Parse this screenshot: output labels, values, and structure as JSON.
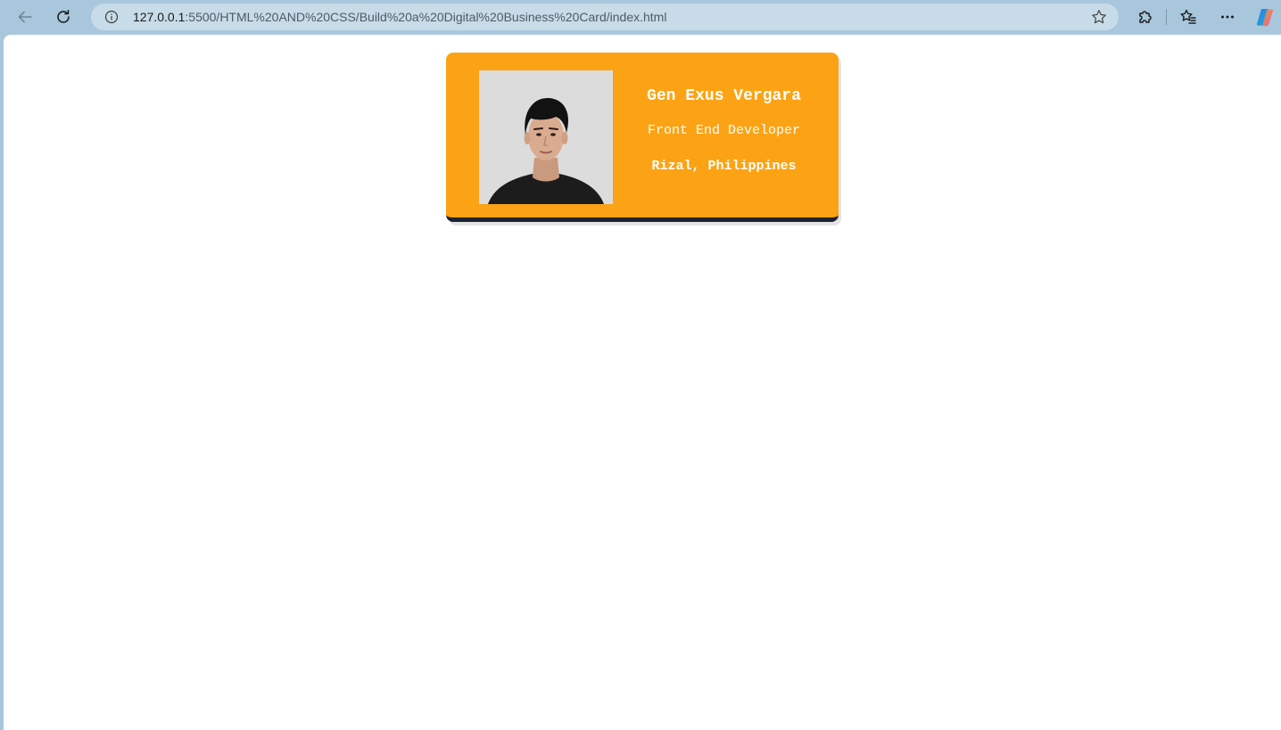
{
  "browser": {
    "url_host": "127.0.0.1",
    "url_rest": ":5500/HTML%20AND%20CSS/Build%20a%20Digital%20Business%20Card/index.html",
    "icons": {
      "back": "arrow-left-icon",
      "reload": "reload-icon",
      "site_info": "info-icon",
      "favorite": "star-icon",
      "extensions": "puzzle-icon",
      "favorites": "favorites-icon",
      "menu": "more-icon",
      "copilot": "copilot-icon"
    }
  },
  "card": {
    "name": "Gen Exus Vergara",
    "role": "Front End Developer",
    "location": "Rizal, Philippines",
    "colors": {
      "background": "#fba315",
      "bottom_border": "#1e2230",
      "text": "#ffffff"
    }
  }
}
